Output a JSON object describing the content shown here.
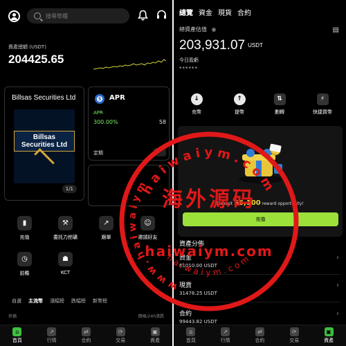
{
  "left": {
    "search": {
      "placeholder": "搜尋幣種"
    },
    "balance": {
      "label": "資產總額 (USDT)",
      "value": "204425.65"
    },
    "broker_card": {
      "title": "Billsas Securities Ltd",
      "logo_text": "Billsas Securities Ltd",
      "page_indicator": "1/1"
    },
    "apr_card": {
      "title": "APR",
      "apr_label": "APR",
      "apr_rate": "300.00%",
      "right_value": "58",
      "term_label": "定期"
    },
    "quick": [
      {
        "label": "充值",
        "icon": "deposit-icon"
      },
      {
        "label": "委託力挖礦",
        "icon": "pickaxe-icon"
      },
      {
        "label": "跟單",
        "icon": "copy-trade-icon"
      },
      {
        "label": "邀請好友",
        "icon": "invite-icon"
      },
      {
        "label": "前瞻",
        "icon": "forecast-icon"
      },
      {
        "label": "KCT",
        "icon": "robot-icon"
      }
    ],
    "market_tabs": [
      "自選",
      "主流幣",
      "漲幅榜",
      "跌幅榜",
      "新幣榜"
    ],
    "market_head": {
      "name": "名稱",
      "price": "價格/24h漲跌"
    }
  },
  "right": {
    "tabs": [
      "總覽",
      "資金",
      "現貨",
      "合約"
    ],
    "total_label": "總資產估值",
    "total_value": "203,931.07",
    "total_unit": "USDT",
    "today_label": "今日盈虧",
    "today_value": "******",
    "actions": [
      {
        "label": "充幣",
        "icon": "deposit-icon"
      },
      {
        "label": "提幣",
        "icon": "withdraw-icon"
      },
      {
        "label": "劃轉",
        "icon": "transfer-icon"
      },
      {
        "label": "快捷買幣",
        "icon": "quick-buy-icon"
      }
    ],
    "promo": {
      "text_pre": "Deposit",
      "text_highlight": "$6,100",
      "text_post": "reward opportunity!",
      "button": "充值"
    },
    "distribution_title": "資產分佈",
    "assets": [
      {
        "name": "資金",
        "value": "61010.00 USDT"
      },
      {
        "name": "現貨",
        "value": "31478.25 USDT"
      },
      {
        "name": "合約",
        "value": "99443.82 USDT"
      }
    ]
  },
  "bottom_nav": [
    {
      "label": "首頁",
      "icon": "home-icon"
    },
    {
      "label": "行情",
      "icon": "market-icon"
    },
    {
      "label": "合約",
      "icon": "contract-icon"
    },
    {
      "label": "交易",
      "icon": "trade-icon"
    },
    {
      "label": "資產",
      "icon": "wallet-icon"
    }
  ],
  "watermark": {
    "text_main": "海外源码",
    "text_url": "haiwaiym.com",
    "text_arc_top": "haiwaiym.com",
    "text_arc_left": "www.haiwaiym",
    "text_arc_bottom": "haiwaiym.com",
    "color": "#e01818"
  }
}
